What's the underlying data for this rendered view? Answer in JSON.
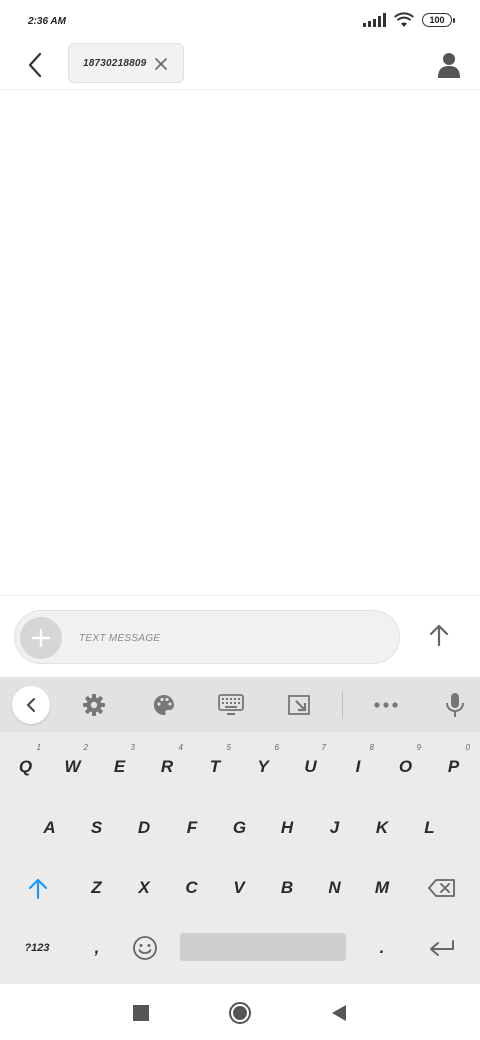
{
  "status_bar": {
    "time": "2:36 AM",
    "battery": "100",
    "icons": [
      "signal-icon",
      "wifi-icon",
      "battery-icon"
    ]
  },
  "header": {
    "recipient": "18730218809",
    "icons": [
      "back-arrow-icon",
      "close-icon",
      "contact-icon"
    ]
  },
  "compose": {
    "placeholder": "TEXT MESSAGE",
    "icons": [
      "plus-icon",
      "send-arrow-icon"
    ]
  },
  "keyboard": {
    "toolbar_icons": [
      "chevron-left-icon",
      "gear-icon",
      "palette-icon",
      "keyboard-icon",
      "resize-icon",
      "more-icon",
      "microphone-icon"
    ],
    "row1": [
      {
        "label": "Q",
        "hint": "1"
      },
      {
        "label": "W",
        "hint": "2"
      },
      {
        "label": "E",
        "hint": "3"
      },
      {
        "label": "R",
        "hint": "4"
      },
      {
        "label": "T",
        "hint": "5"
      },
      {
        "label": "Y",
        "hint": "6"
      },
      {
        "label": "U",
        "hint": "7"
      },
      {
        "label": "I",
        "hint": "8"
      },
      {
        "label": "O",
        "hint": "9"
      },
      {
        "label": "P",
        "hint": "0"
      }
    ],
    "row2": [
      "A",
      "S",
      "D",
      "F",
      "G",
      "H",
      "J",
      "K",
      "L"
    ],
    "row3": [
      "Z",
      "X",
      "C",
      "V",
      "B",
      "N",
      "M"
    ],
    "row4": {
      "symbols": "?123",
      "comma": ",",
      "period": "."
    },
    "colors": {
      "shift_accent": "#2196f3",
      "background": "#ebebeb",
      "toolbar": "#e2e2e2"
    }
  },
  "nav": {
    "icons": [
      "recent-apps-icon",
      "home-icon",
      "back-icon"
    ]
  }
}
